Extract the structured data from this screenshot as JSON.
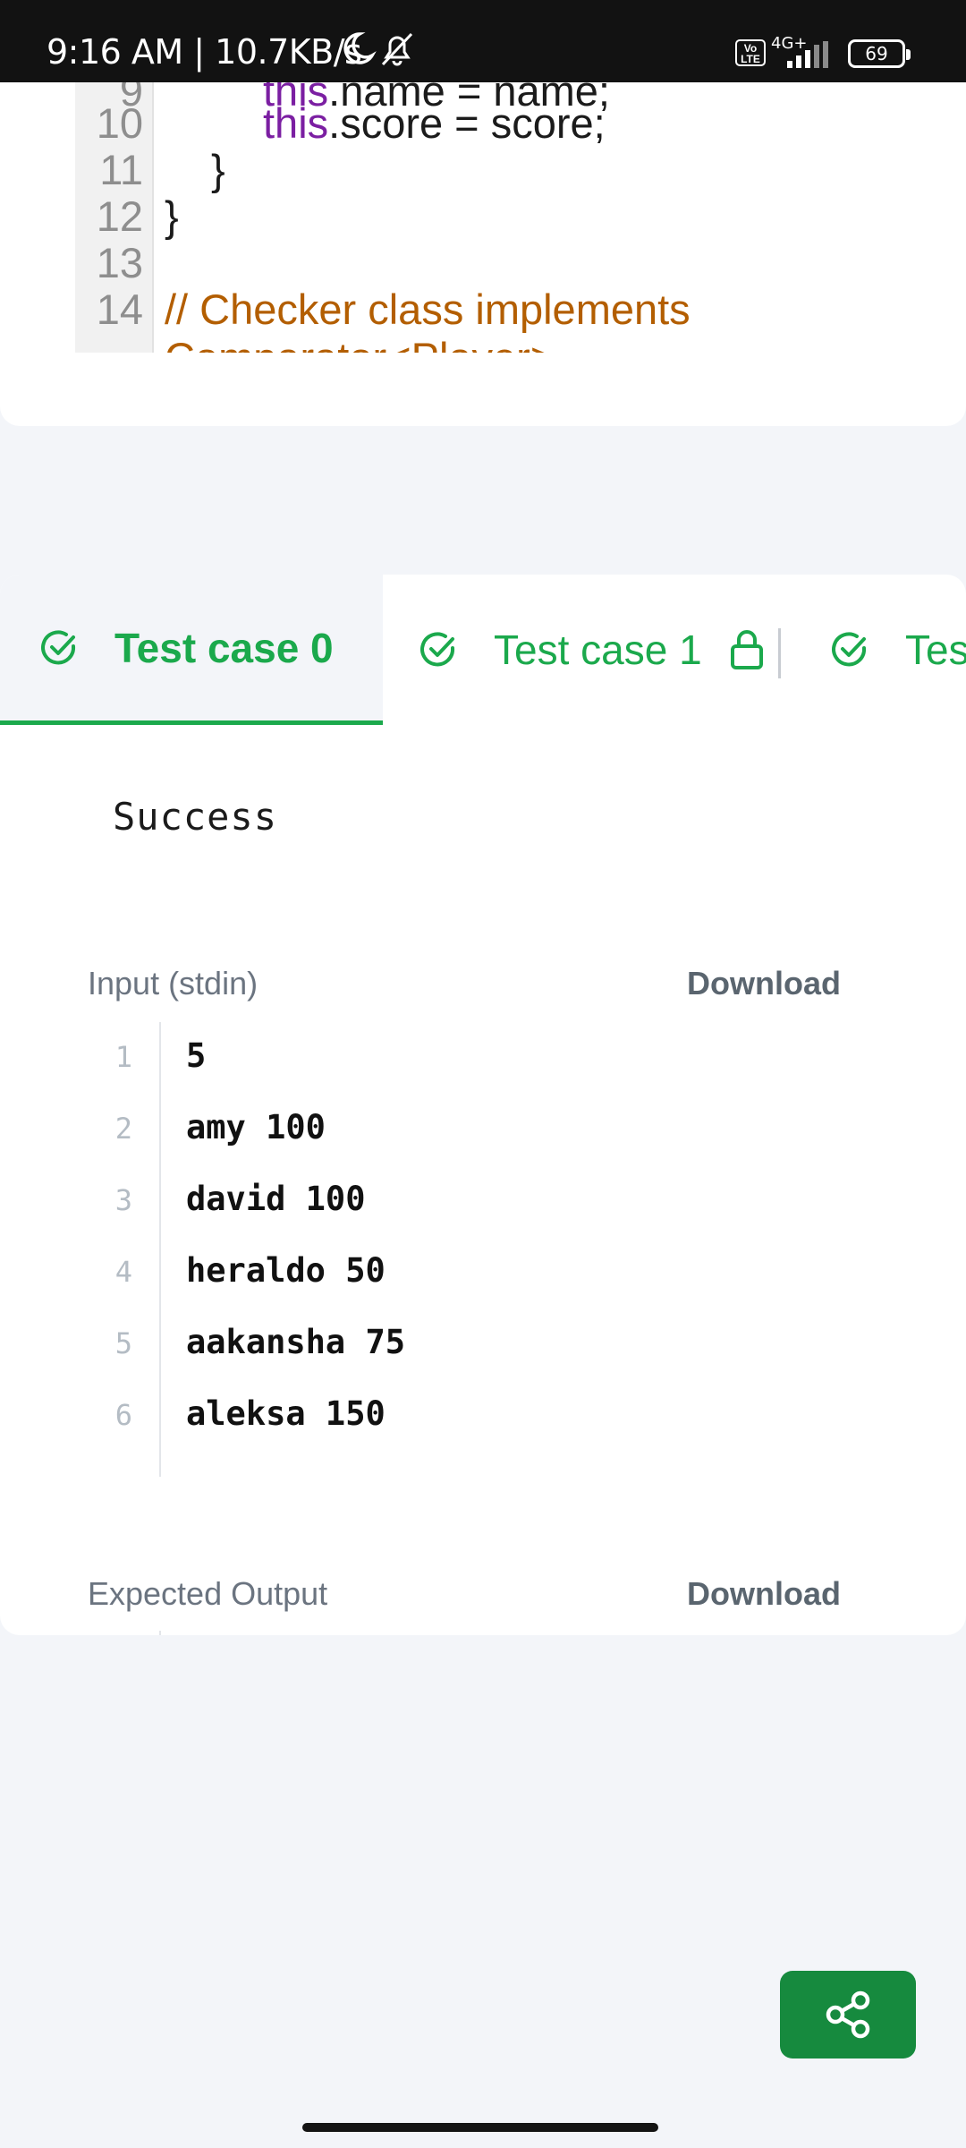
{
  "status_bar": {
    "time": "9:16 AM | 10.7KB/s",
    "volte": "Vo LTE",
    "network": "4G+",
    "battery": "69"
  },
  "code": {
    "lines": [
      {
        "num": "9",
        "text": "this.name = name;"
      },
      {
        "num": "10",
        "kw": "this",
        "text": ".score = score;"
      },
      {
        "num": "11",
        "text": "}"
      },
      {
        "num": "12",
        "text": "}"
      },
      {
        "num": "13",
        "text": ""
      },
      {
        "num": "14",
        "text": "// Checker class implements"
      },
      {
        "num": "",
        "text": "Comparator<Player>"
      }
    ]
  },
  "tabs": [
    {
      "label": "Test case 0",
      "active": true
    },
    {
      "label": "Test case 1",
      "locked": true
    },
    {
      "label": "Test"
    }
  ],
  "result": {
    "status": "Success"
  },
  "input_section": {
    "label": "Input (stdin)",
    "download": "Download",
    "lines": [
      {
        "num": "1",
        "value": "5"
      },
      {
        "num": "2",
        "value": "amy 100"
      },
      {
        "num": "3",
        "value": "david 100"
      },
      {
        "num": "4",
        "value": "heraldo 50"
      },
      {
        "num": "5",
        "value": "aakansha 75"
      },
      {
        "num": "6",
        "value": "aleksa 150"
      }
    ]
  },
  "expected_section": {
    "label": "Expected Output",
    "download": "Download"
  },
  "colors": {
    "accent_green": "#1ba94c",
    "share_green": "#168a3e"
  },
  "icons": [
    "check-circle-icon",
    "lock-icon",
    "share-icon",
    "moon-icon",
    "bell-off-icon",
    "signal-icon",
    "battery-icon"
  ]
}
